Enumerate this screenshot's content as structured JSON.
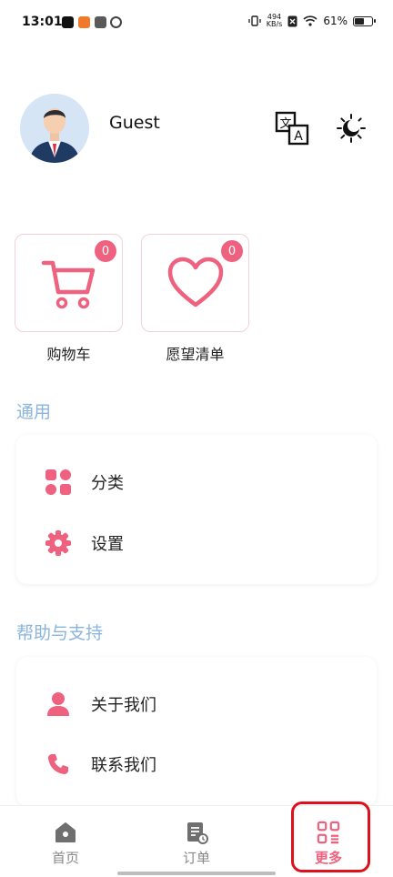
{
  "status_bar": {
    "time": "13:01",
    "net_speed_value": "494",
    "net_speed_unit": "KB/s",
    "battery": "61%",
    "battery_level": 0.61
  },
  "profile": {
    "name": "Guest"
  },
  "quick_actions": [
    {
      "label": "购物车",
      "badge": "0",
      "icon": "cart-icon"
    },
    {
      "label": "愿望清单",
      "badge": "0",
      "icon": "heart-icon"
    }
  ],
  "sections": [
    {
      "title": "通用",
      "items": [
        {
          "label": "分类",
          "icon": "category-icon"
        },
        {
          "label": "设置",
          "icon": "gear-icon"
        }
      ]
    },
    {
      "title": "帮助与支持",
      "items": [
        {
          "label": "关于我们",
          "icon": "user-icon"
        },
        {
          "label": "联系我们",
          "icon": "phone-icon"
        }
      ]
    }
  ],
  "nav": [
    {
      "label": "首页",
      "icon": "home-icon",
      "active": false
    },
    {
      "label": "订单",
      "icon": "orders-icon",
      "active": false
    },
    {
      "label": "更多",
      "icon": "more-icon",
      "active": true
    }
  ],
  "colors": {
    "accent": "#ee6280",
    "section_title": "#89b4dd",
    "highlight": "#e0101a"
  }
}
